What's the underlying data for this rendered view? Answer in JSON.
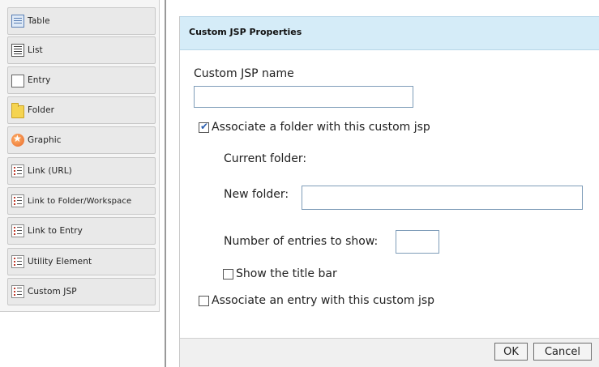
{
  "palette": {
    "items": [
      {
        "label": "Table",
        "icon": "table-icon"
      },
      {
        "label": "List",
        "icon": "list-icon"
      },
      {
        "label": "Entry",
        "icon": "entry-icon"
      },
      {
        "label": "Folder",
        "icon": "folder-icon"
      },
      {
        "label": "Graphic",
        "icon": "graphic-icon"
      },
      {
        "label": "Link (URL)",
        "icon": "link-url-icon"
      },
      {
        "label": "Link to Folder/Workspace",
        "icon": "link-folder-icon"
      },
      {
        "label": "Link to Entry",
        "icon": "link-entry-icon"
      },
      {
        "label": "Utility Element",
        "icon": "utility-element-icon"
      },
      {
        "label": "Custom JSP",
        "icon": "custom-jsp-icon"
      }
    ]
  },
  "dialog": {
    "title": "Custom JSP Properties",
    "jsp_name_label": "Custom JSP name",
    "jsp_name_value": "",
    "assoc_folder_label": "Associate a folder with this custom jsp",
    "assoc_folder_checked": true,
    "current_folder_label": "Current folder:",
    "new_folder_label": "New folder:",
    "new_folder_value": "",
    "entries_label": "Number of entries to show:",
    "entries_value": "",
    "show_title_label": "Show the title bar",
    "show_title_checked": false,
    "assoc_entry_label": "Associate an entry with this custom jsp",
    "assoc_entry_checked": false,
    "ok_label": "OK",
    "cancel_label": "Cancel"
  },
  "colors": {
    "header_bg": "#d5ecf8",
    "palette_item_bg": "#e9e9e9",
    "footer_bg": "#f0f0f0"
  }
}
